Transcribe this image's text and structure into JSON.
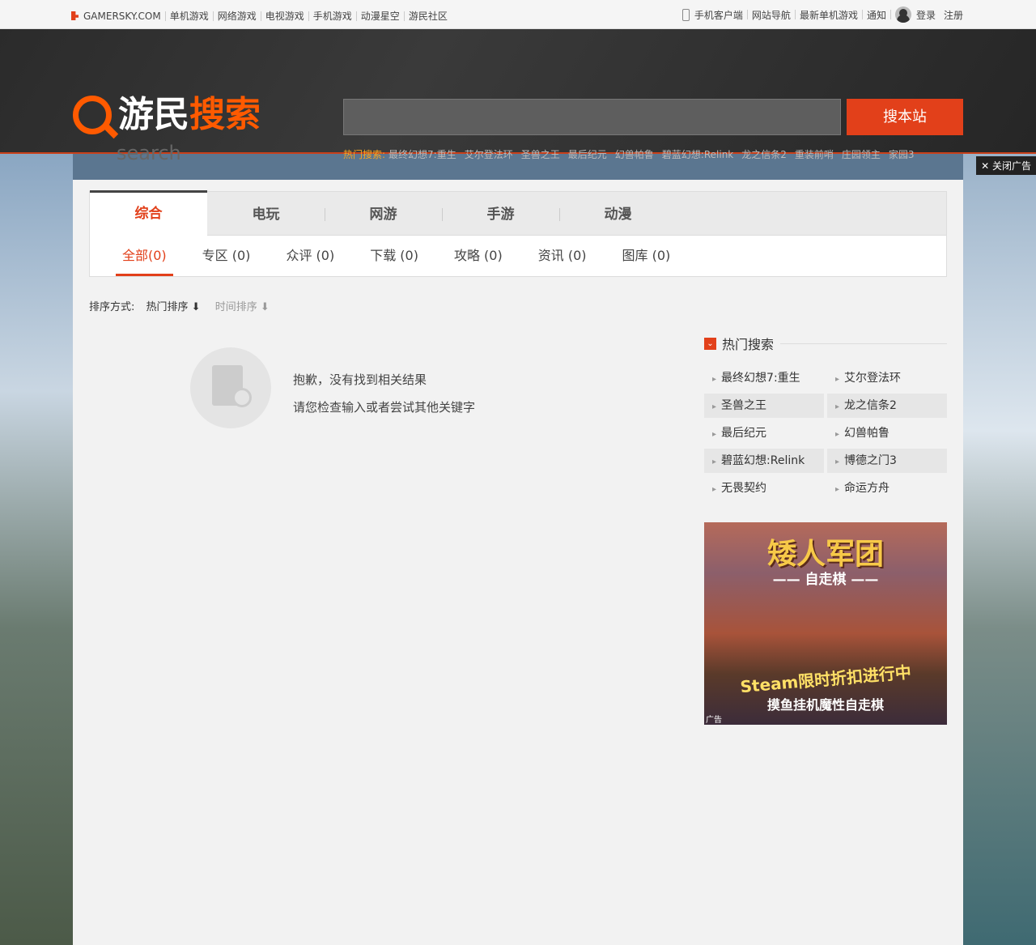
{
  "topbar": {
    "site": "GAMERSKY.COM",
    "links": [
      "单机游戏",
      "网络游戏",
      "电视游戏",
      "手机游戏",
      "动漫星空",
      "游民社区"
    ],
    "right": [
      "手机客户端",
      "网站导航",
      "最新单机游戏",
      "通知"
    ],
    "login": "登录",
    "register": "注册"
  },
  "header": {
    "brand_a": "游民",
    "brand_b": "搜索",
    "brand_sub": "search",
    "search_value": "",
    "search_button": "搜本站",
    "hot_label": "热门搜索:",
    "hot": [
      "最终幻想7:重生",
      "艾尔登法环",
      "圣兽之王",
      "最后纪元",
      "幻兽帕鲁",
      "碧蓝幻想:Relink",
      "龙之信条2",
      "重装前哨",
      "庄园领主",
      "家园3"
    ]
  },
  "close_ad": "关闭广告",
  "tabs": [
    "综合",
    "电玩",
    "网游",
    "手游",
    "动漫"
  ],
  "subtabs": [
    "全部(0)",
    "专区 (0)",
    "众评 (0)",
    "下载 (0)",
    "攻略 (0)",
    "资讯 (0)",
    "图库 (0)"
  ],
  "sort": {
    "label": "排序方式:",
    "hot": "热门排序",
    "time": "时间排序"
  },
  "empty": {
    "line1": "抱歉，没有找到相关结果",
    "line2": "请您检查输入或者尝试其他关键字"
  },
  "sidebar": {
    "title": "热门搜索",
    "items": [
      "最终幻想7:重生",
      "艾尔登法环",
      "圣兽之王",
      "龙之信条2",
      "最后纪元",
      "幻兽帕鲁",
      "碧蓝幻想:Relink",
      "博德之门3",
      "无畏契约",
      "命运方舟"
    ]
  },
  "ad": {
    "title": "矮人军团",
    "subtitle": "—— 自走棋 ——",
    "line1": "Steam限时折扣进行中",
    "line2": "摸鱼挂机魔性自走棋",
    "tag": "广告"
  }
}
